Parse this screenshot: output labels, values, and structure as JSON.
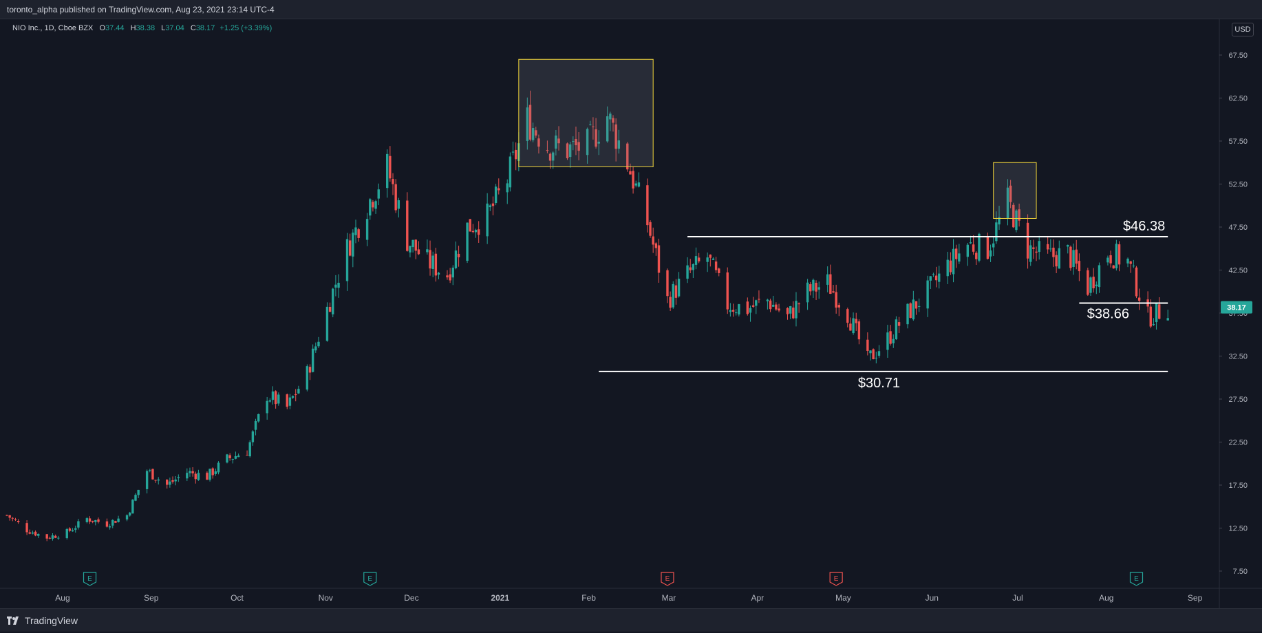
{
  "header": {
    "publish_line": "toronto_alpha published on TradingView.com, Aug 23, 2021 23:14 UTC-4"
  },
  "legend": {
    "symbol": "NIO Inc., 1D, Cboe BZX",
    "o_label": "O",
    "o_value": "37.44",
    "h_label": "H",
    "h_value": "38.38",
    "l_label": "L",
    "l_value": "37.04",
    "c_label": "C",
    "c_value": "38.17",
    "change": "+1.25 (+3.39%)"
  },
  "currency_button": "USD",
  "footer": {
    "brand": "TradingView"
  },
  "colors": {
    "background": "#131722",
    "up": "#26a69a",
    "down": "#ef5350",
    "box": "#f0d43a",
    "line": "#ffffff"
  },
  "chart_data": {
    "type": "candlestick",
    "ylim": [
      5.5,
      71.5
    ],
    "y_ticks": [
      "67.50",
      "62.50",
      "57.50",
      "52.50",
      "47.50",
      "42.50",
      "37.50",
      "32.50",
      "27.50",
      "22.50",
      "17.50",
      "12.50",
      "7.50"
    ],
    "x_ticks": [
      "Aug",
      "Sep",
      "Oct",
      "Nov",
      "Dec",
      "2021",
      "Feb",
      "Mar",
      "Apr",
      "May",
      "Jun",
      "Jul",
      "Aug",
      "Sep"
    ],
    "date_range": [
      "2020-07-13",
      "2021-09-10"
    ],
    "current_price": "38.17",
    "close_series": [
      [
        "2020-07-13",
        14.0
      ],
      [
        "2020-07-20",
        12.3
      ],
      [
        "2020-07-27",
        11.4
      ],
      [
        "2020-08-03",
        12.0
      ],
      [
        "2020-08-10",
        13.6
      ],
      [
        "2020-08-17",
        13.0
      ],
      [
        "2020-08-24",
        14.0
      ],
      [
        "2020-08-31",
        19.2
      ],
      [
        "2020-09-07",
        17.5
      ],
      [
        "2020-09-14",
        19.0
      ],
      [
        "2020-09-21",
        18.5
      ],
      [
        "2020-09-28",
        20.5
      ],
      [
        "2020-10-05",
        21.5
      ],
      [
        "2020-10-12",
        28.0
      ],
      [
        "2020-10-19",
        26.5
      ],
      [
        "2020-10-26",
        30.5
      ],
      [
        "2020-11-02",
        38.0
      ],
      [
        "2020-11-09",
        45.0
      ],
      [
        "2020-11-16",
        50.0
      ],
      [
        "2020-11-23",
        54.5
      ],
      [
        "2020-11-30",
        46.0
      ],
      [
        "2020-12-07",
        43.5
      ],
      [
        "2020-12-14",
        42.0
      ],
      [
        "2020-12-21",
        47.5
      ],
      [
        "2020-12-28",
        48.7
      ],
      [
        "2021-01-04",
        53.0
      ],
      [
        "2021-01-11",
        60.0
      ],
      [
        "2021-01-18",
        57.0
      ],
      [
        "2021-01-25",
        56.5
      ],
      [
        "2021-02-01",
        57.0
      ],
      [
        "2021-02-08",
        60.5
      ],
      [
        "2021-02-15",
        55.0
      ],
      [
        "2021-02-22",
        48.0
      ],
      [
        "2021-03-01",
        39.0
      ],
      [
        "2021-03-08",
        42.0
      ],
      [
        "2021-03-15",
        44.0
      ],
      [
        "2021-03-22",
        38.5
      ],
      [
        "2021-03-29",
        38.0
      ],
      [
        "2021-04-05",
        39.0
      ],
      [
        "2021-04-12",
        37.0
      ],
      [
        "2021-04-19",
        40.0
      ],
      [
        "2021-04-26",
        41.0
      ],
      [
        "2021-05-03",
        37.5
      ],
      [
        "2021-05-10",
        32.0
      ],
      [
        "2021-05-17",
        34.5
      ],
      [
        "2021-05-24",
        37.5
      ],
      [
        "2021-05-31",
        40.0
      ],
      [
        "2021-06-07",
        43.0
      ],
      [
        "2021-06-14",
        45.5
      ],
      [
        "2021-06-21",
        45.0
      ],
      [
        "2021-06-28",
        50.5
      ],
      [
        "2021-07-05",
        45.0
      ],
      [
        "2021-07-12",
        44.0
      ],
      [
        "2021-07-19",
        44.5
      ],
      [
        "2021-07-26",
        40.5
      ],
      [
        "2021-08-02",
        44.5
      ],
      [
        "2021-08-09",
        43.5
      ],
      [
        "2021-08-16",
        37.0
      ],
      [
        "2021-08-23",
        38.17
      ]
    ],
    "earnings_markers": [
      {
        "date": "2020-08-11",
        "label": "E",
        "color": "#26a69a"
      },
      {
        "date": "2020-11-17",
        "label": "E",
        "color": "#26a69a"
      },
      {
        "date": "2021-03-01",
        "label": "E",
        "color": "#ef5350"
      },
      {
        "date": "2021-04-29",
        "label": "E",
        "color": "#ef5350"
      },
      {
        "date": "2021-08-12",
        "label": "E",
        "color": "#26a69a"
      }
    ],
    "horizontal_lines": [
      {
        "label": "$46.38",
        "value": 46.38,
        "from": "2021-03-08",
        "to": "2021-08-23"
      },
      {
        "label": "$38.66",
        "value": 38.66,
        "from": "2021-07-23",
        "to": "2021-08-23"
      },
      {
        "label": "$30.71",
        "value": 30.71,
        "from": "2021-02-05",
        "to": "2021-08-23"
      }
    ],
    "boxes": [
      {
        "from": "2021-01-08",
        "to": "2021-02-24",
        "low": 54.5,
        "high": 67.0
      },
      {
        "from": "2021-06-23",
        "to": "2021-07-08",
        "low": 48.5,
        "high": 55.0
      }
    ]
  }
}
